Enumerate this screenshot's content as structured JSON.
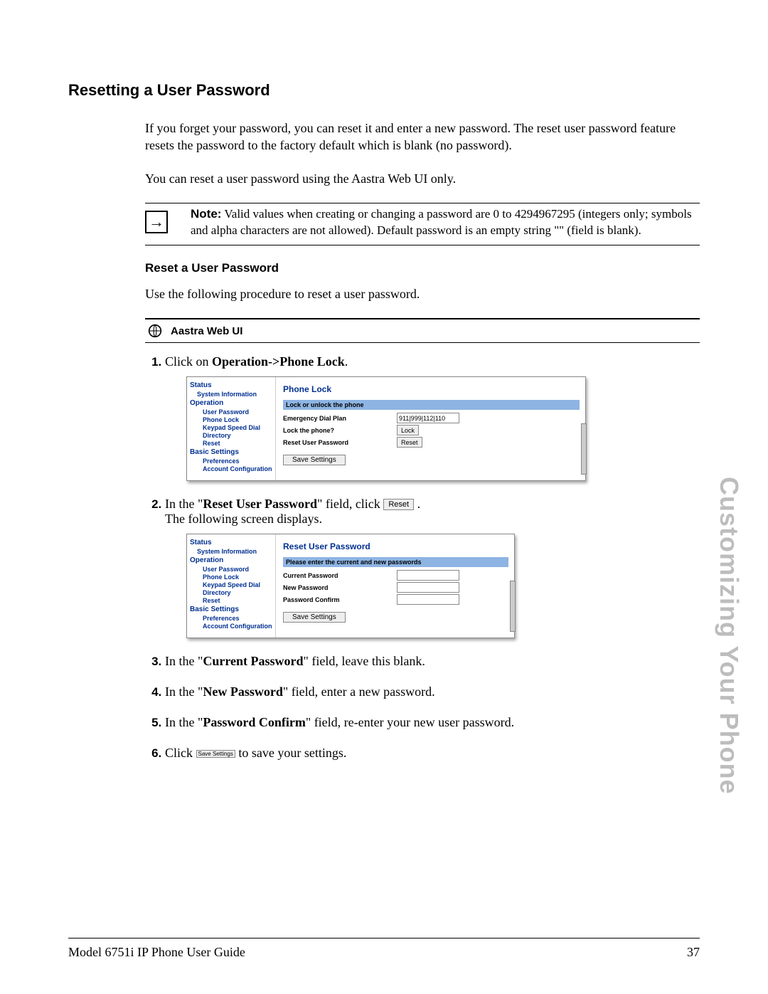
{
  "heading": "Resetting a User Password",
  "intro1": "If you forget your password, you can reset it and enter a new password. The reset user password feature resets the password to the factory default which is blank (no password).",
  "intro2": "You can reset a user password using the Aastra Web UI only.",
  "note_label": "Note:",
  "note_body": " Valid values when creating or changing a password are 0 to 4294967295 (integers only; symbols and alpha characters are not allowed). Default password is an empty string \"\" (field is blank).",
  "sub_heading": "Reset a User Password",
  "sub_intro": "Use the following procedure to reset a user password.",
  "ui_header": "Aastra Web UI",
  "step1_a": "Click on ",
  "step1_b": "Operation->Phone Lock",
  "step1_c": ".",
  "step2_a": "In the \"",
  "step2_b": "Reset User Password",
  "step2_c": "\" field, click ",
  "step2_btn": "Reset",
  "step2_d": " .",
  "step2_line2": "The following screen displays.",
  "step3_a": "In the \"",
  "step3_b": "Current Password",
  "step3_c": "\" field, leave this blank.",
  "step4_a": "In the \"",
  "step4_b": "New Password",
  "step4_c": "\" field, enter a new password.",
  "step5_a": "In the \"",
  "step5_b": "Password Confirm",
  "step5_c": "\" field, re-enter your new user password.",
  "step6_a": "Click ",
  "step6_btn": "Save Settings",
  "step6_b": " to save your settings.",
  "side": {
    "status": "Status",
    "sysinfo": "System Information",
    "operation": "Operation",
    "userpw": "User Password",
    "phonelock": "Phone Lock",
    "ksd": "Keypad Speed Dial",
    "directory": "Directory",
    "reset": "Reset",
    "bs": "Basic Settings",
    "pref": "Preferences",
    "acct": "Account Configuration"
  },
  "panel1": {
    "title": "Phone Lock",
    "band": "Lock or unlock the phone",
    "r1": "Emergency Dial Plan",
    "r1v": "911|999|112|110",
    "r2": "Lock the phone?",
    "r2v": "Lock",
    "r3": "Reset User Password",
    "r3v": "Reset",
    "save": "Save Settings"
  },
  "panel2": {
    "title": "Reset User Password",
    "band": "Please enter the current and new passwords",
    "r1": "Current Password",
    "r2": "New Password",
    "r3": "Password Confirm",
    "save": "Save Settings"
  },
  "vertical": "Customizing Your Phone",
  "footer_left": "Model 6751i IP Phone User Guide",
  "footer_right": "37"
}
